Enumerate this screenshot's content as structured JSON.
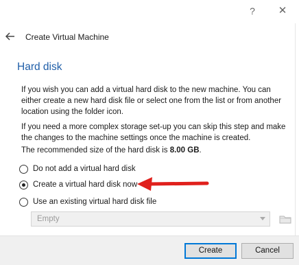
{
  "window": {
    "help_glyph": "?",
    "close_glyph": "✕"
  },
  "header": {
    "title": "Create Virtual Machine"
  },
  "page": {
    "title": "Hard disk",
    "para1": "If you wish you can add a virtual hard disk to the new machine. You can either create a new hard disk file or select one from the list or from another location using the folder icon.",
    "para2": "If you need a more complex storage set-up you can skip this step and make the changes to the machine settings once the machine is created.",
    "recommended_prefix": "The recommended size of the hard disk is ",
    "recommended_size": "8.00 GB",
    "recommended_suffix": "."
  },
  "options": [
    {
      "label": "Do not add a virtual hard disk",
      "checked": false
    },
    {
      "label": "Create a virtual hard disk now",
      "checked": true
    },
    {
      "label": "Use an existing virtual hard disk file",
      "checked": false
    }
  ],
  "disk_select": {
    "value": "Empty"
  },
  "buttons": {
    "create": "Create",
    "cancel": "Cancel"
  },
  "colors": {
    "title_blue": "#1f5ea8",
    "annotation_arrow": "#e0201c",
    "default_button_border": "#0078d7"
  },
  "icons": {
    "back": "back-arrow-icon",
    "folder": "folder-icon",
    "dropdown": "chevron-down-icon"
  }
}
